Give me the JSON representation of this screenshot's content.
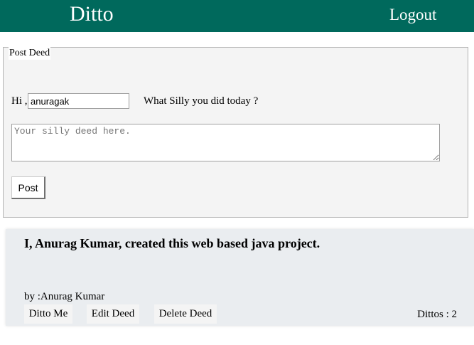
{
  "header": {
    "brand": "Ditto",
    "logout_label": "Logout"
  },
  "post_form": {
    "legend": "Post Deed",
    "greeting": "Hi ,",
    "username_value": "anuragak",
    "question": "What Silly you did today ?",
    "deed_placeholder": "Your silly deed here.",
    "post_label": "Post"
  },
  "deeds": [
    {
      "text": "I, Anurag Kumar, created this web based java project.",
      "author_line": "by :Anurag Kumar",
      "ditto_label": "Ditto Me",
      "edit_label": "Edit Deed",
      "delete_label": "Delete Deed",
      "dittos_text": "Dittos : 2"
    }
  ],
  "colors": {
    "header_bg": "#00695c",
    "header_text": "#ffffff",
    "form_bg": "#f4f4f4",
    "card_bg": "#eaedf0"
  }
}
